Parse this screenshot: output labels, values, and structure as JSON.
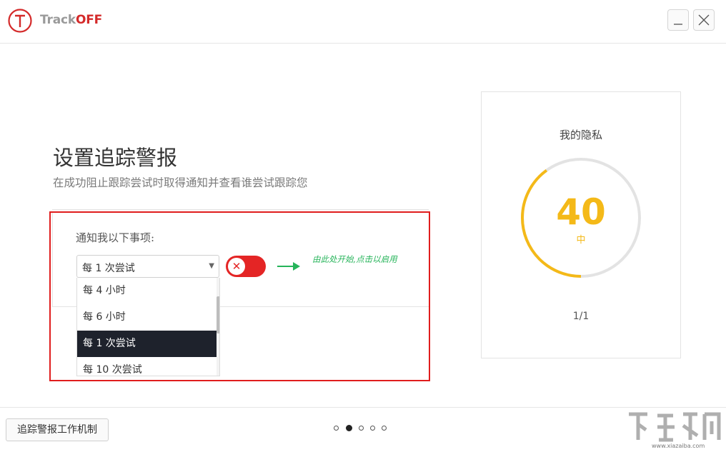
{
  "app": {
    "brand_part1": "Track",
    "brand_part2": "OFF",
    "colors": {
      "brand_red": "#d42a2a",
      "toggle_red": "#e42525",
      "hint_green": "#26b45a",
      "score_yellow": "#f4b918",
      "selected_dark": "#1e222c"
    }
  },
  "window_controls": {
    "minimize_icon": "minimize-icon",
    "close_icon": "close-icon"
  },
  "main": {
    "title": "设置追踪警报",
    "subtitle": "在成功阻止跟踪尝试时取得通知并查看谁尝试跟踪您",
    "notify_label": "通知我以下事项:",
    "frequency_select": {
      "selected": "每 1 次尝试",
      "options": [
        {
          "label": "每 4 小时",
          "selected": false
        },
        {
          "label": "每 6 小时",
          "selected": false
        },
        {
          "label": "每 1 次尝试",
          "selected": true
        },
        {
          "label": "每 10 次尝试",
          "selected": false
        }
      ]
    },
    "toggle": {
      "state": "off",
      "icon": "x-icon"
    },
    "hint_text": "由此处开始,点击以启用"
  },
  "privacy": {
    "title": "我的隐私",
    "score": "40",
    "score_fraction": 0.4,
    "level": "中",
    "pager": "1/1"
  },
  "footer": {
    "how_it_works_button": "追踪警报工作机制",
    "pagination": {
      "count": 5,
      "active_index": 1
    }
  },
  "watermark": {
    "url": "www.xiazaiba.com"
  }
}
